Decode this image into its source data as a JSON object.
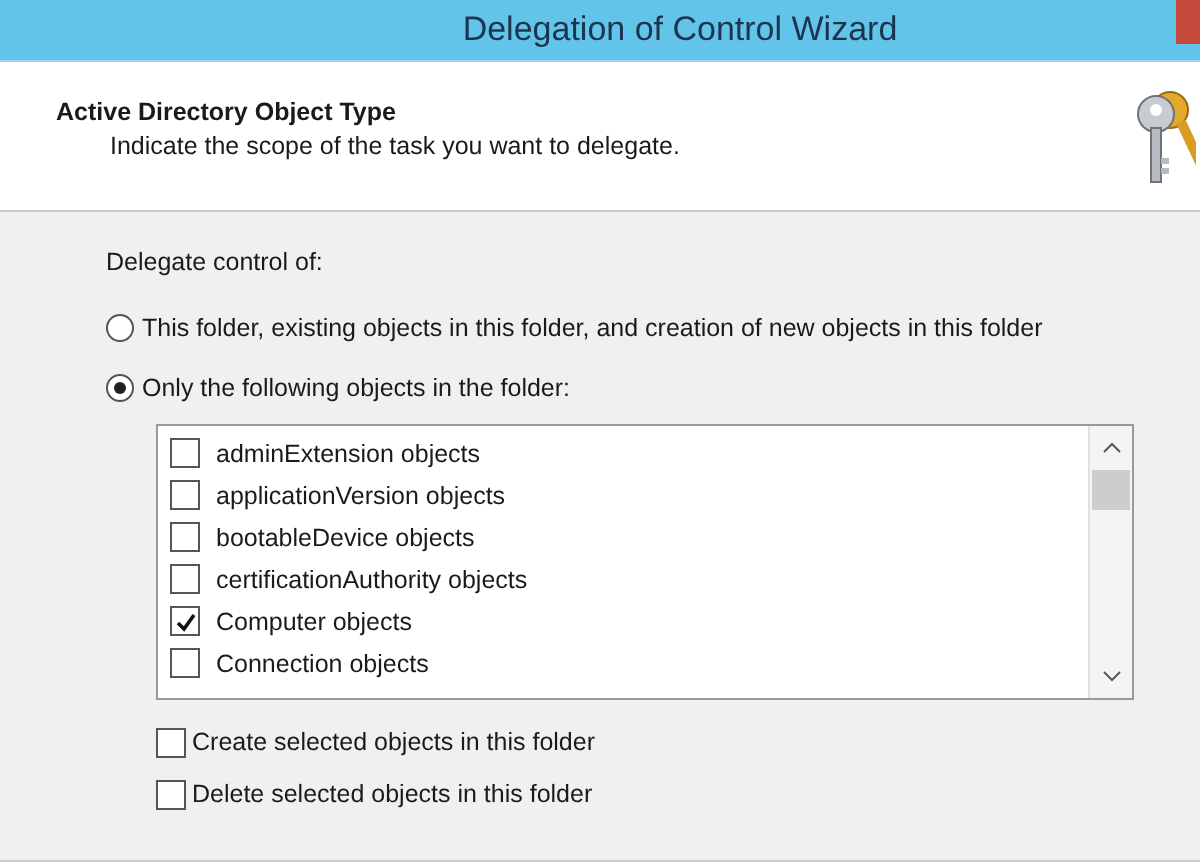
{
  "window": {
    "title": "Delegation of Control Wizard"
  },
  "header": {
    "title": "Active Directory Object Type",
    "subtitle": "Indicate the scope of the task you want to delegate."
  },
  "group_label": "Delegate control of:",
  "radios": [
    {
      "label": "This folder, existing objects in this folder, and creation of new objects in this folder",
      "selected": false
    },
    {
      "label": "Only the following objects in the folder:",
      "selected": true
    }
  ],
  "object_list": [
    {
      "label": "adminExtension objects",
      "checked": false
    },
    {
      "label": "applicationVersion objects",
      "checked": false
    },
    {
      "label": "bootableDevice objects",
      "checked": false
    },
    {
      "label": "certificationAuthority objects",
      "checked": false
    },
    {
      "label": "Computer objects",
      "checked": true
    },
    {
      "label": "Connection objects",
      "checked": false
    }
  ],
  "options": [
    {
      "label": "Create selected objects in this folder",
      "checked": false
    },
    {
      "label": "Delete selected objects in this folder",
      "checked": false
    }
  ]
}
